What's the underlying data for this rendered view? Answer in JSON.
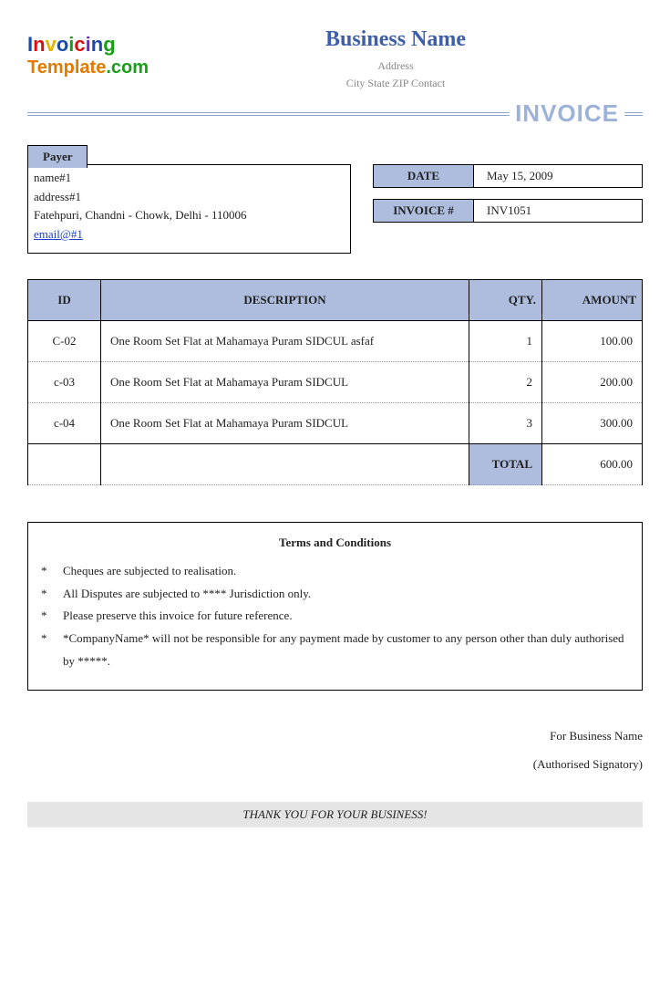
{
  "logo": {
    "line1": "Invoicing",
    "line2_a": "Template",
    "line2_b": ".com"
  },
  "business": {
    "name": "Business Name",
    "address": "Address",
    "city_line": "City State ZIP Contact"
  },
  "invoice_title": "INVOICE",
  "payer": {
    "tab": "Payer",
    "name": "name#1",
    "addr": "address#1",
    "city": "Fatehpuri, Chandni - Chowk, Delhi - 110006",
    "email": "email@#1"
  },
  "meta": {
    "date_label": "DATE",
    "date_value": "May 15, 2009",
    "inv_label": "INVOICE #",
    "inv_value": "INV1051"
  },
  "columns": {
    "id": "ID",
    "desc": "DESCRIPTION",
    "qty": "QTY.",
    "amount": "AMOUNT"
  },
  "items": [
    {
      "id": "C-02",
      "desc": "One Room Set Flat at Mahamaya Puram SIDCUL asfaf",
      "qty": "1",
      "amount": "100.00"
    },
    {
      "id": "c-03",
      "desc": "One Room Set Flat at Mahamaya Puram SIDCUL",
      "qty": "2",
      "amount": "200.00"
    },
    {
      "id": "c-04",
      "desc": "One Room Set Flat at Mahamaya Puram SIDCUL",
      "qty": "3",
      "amount": "300.00"
    }
  ],
  "total": {
    "label": "TOTAL",
    "value": "600.00"
  },
  "terms": {
    "title": "Terms and Conditions",
    "bullets": [
      "*",
      "*",
      "*",
      "*"
    ],
    "lines": [
      "Cheques are subjected to realisation.",
      "All Disputes are subjected to **** Jurisdiction only.",
      "Please preserve this invoice for future reference.",
      "*CompanyName* will not be responsible for any payment made by customer to any person other than duly authorised by *****."
    ]
  },
  "signature": {
    "for_line": "For Business Name",
    "role": "(Authorised Signatory)"
  },
  "footer": "THANK YOU FOR YOUR BUSINESS!"
}
